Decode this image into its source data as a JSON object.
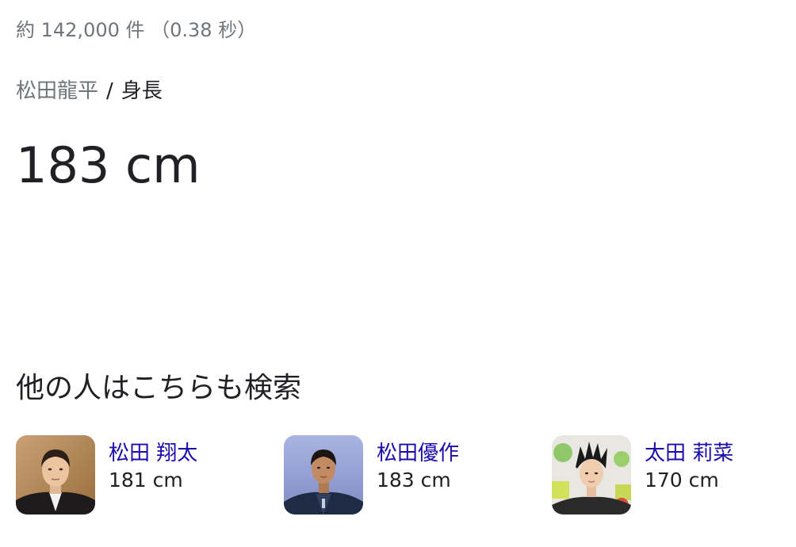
{
  "results_stats": "約 142,000 件 （0.38 秒）",
  "breadcrumb": {
    "entity": "松田龍平",
    "separator": "/",
    "attribute": "身長"
  },
  "answer": "183 cm",
  "people_also_search": {
    "heading": "他の人はこちらも検索",
    "items": [
      {
        "name": "松田 翔太",
        "height": "181 cm"
      },
      {
        "name": "松田優作",
        "height": "183 cm"
      },
      {
        "name": "太田 莉菜",
        "height": "170 cm"
      }
    ]
  },
  "colors": {
    "link": "#1a0dab",
    "muted": "#70757a",
    "text": "#202124"
  }
}
